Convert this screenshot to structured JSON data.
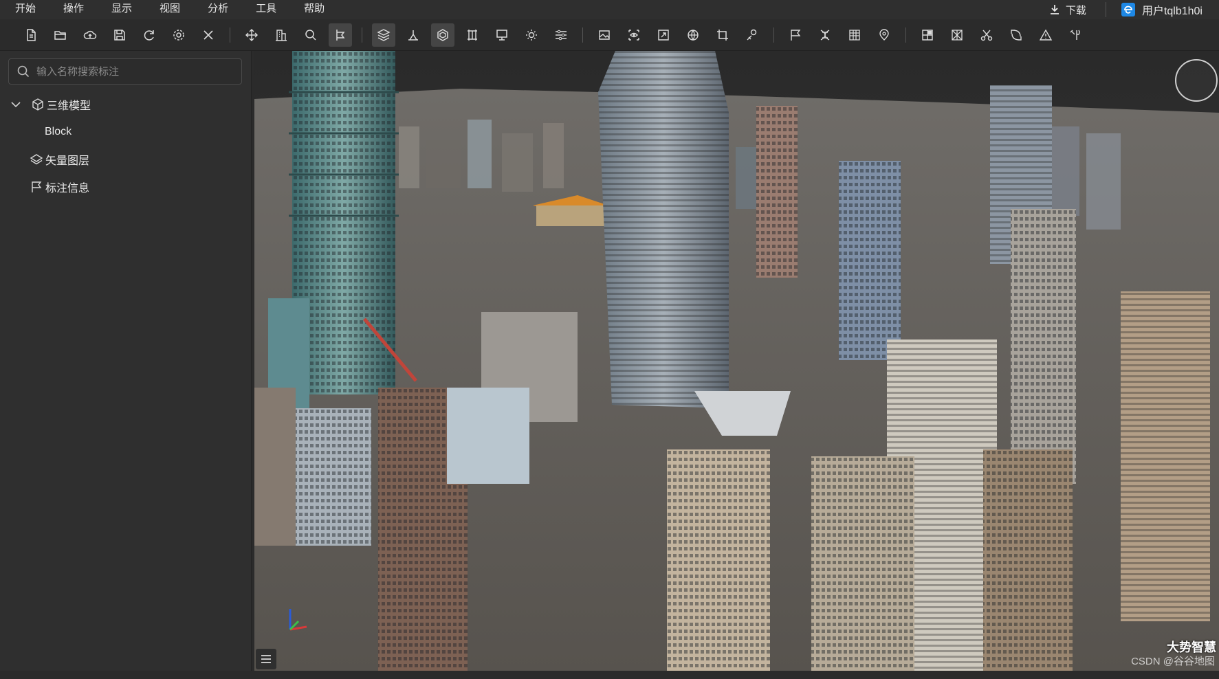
{
  "menu": [
    "开始",
    "操作",
    "显示",
    "视图",
    "分析",
    "工具",
    "帮助"
  ],
  "header": {
    "download_label": "下载",
    "user_label": "用户tqlb1h0i"
  },
  "toolbar": {
    "groups": [
      [
        "new-file-icon",
        "open-folder-icon",
        "cloud-upload-icon",
        "save-icon",
        "refresh-icon",
        "settings-gear-icon",
        "close-icon"
      ],
      [
        "pan-move-icon",
        "building-icon",
        "zoom-search-icon",
        "measure-icon"
      ],
      [
        "layers-stack-icon",
        "terrain-icon",
        "model-hex-icon",
        "grid-frame-icon",
        "monitor-icon",
        "sun-icon",
        "sliders-icon"
      ],
      [
        "image-icon",
        "view-eye-icon",
        "fullscreen-icon",
        "globe-icon",
        "crop-icon",
        "tag-icon"
      ],
      [
        "flag-icon",
        "dna-icon",
        "table-icon",
        "location-pin-icon"
      ],
      [
        "grid-select-icon",
        "clip-box-icon",
        "scissors-icon",
        "transform-icon",
        "warning-triangle-icon",
        "tools-icon"
      ]
    ],
    "active": [
      "measure-icon",
      "layers-stack-icon",
      "model-hex-icon"
    ]
  },
  "sidebar": {
    "search_placeholder": "输入名称搜索标注",
    "tree": {
      "model_group": "三维模型",
      "model_child": "Block",
      "vector_layer": "矢量图层",
      "annotation": "标注信息"
    }
  },
  "viewport": {
    "watermark": "CSDN @谷谷地图",
    "brand": "大势智慧"
  },
  "colors": {
    "panel_bg": "#2f2f2f",
    "toolbar_bg": "#2b2b2b",
    "accent": "#1e88e5",
    "compass_needle": "#e53935"
  }
}
